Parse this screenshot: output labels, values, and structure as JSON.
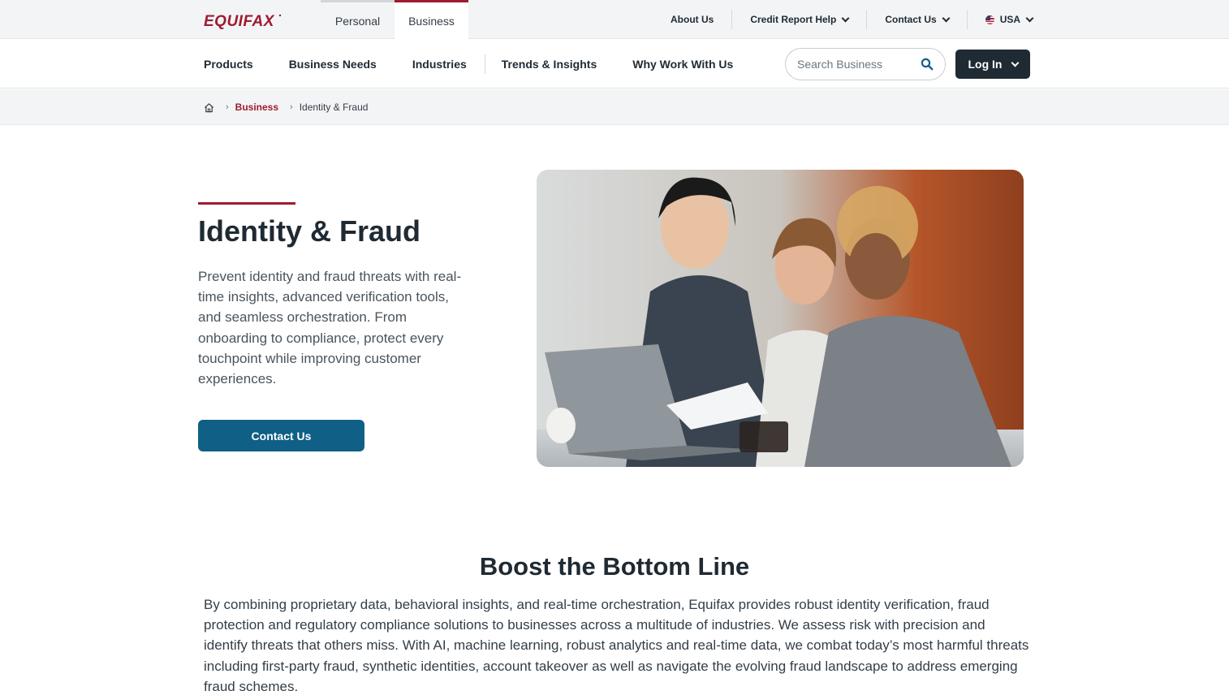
{
  "brand": {
    "logo_text": "EQUIFAX",
    "accent": "#9e1b32",
    "dark": "#1f2a33",
    "cta_blue": "#0f5f86"
  },
  "segment_tabs": {
    "personal": "Personal",
    "business": "Business",
    "active": "Business"
  },
  "utility_nav": {
    "about": "About Us",
    "credit_help": "Credit Report Help",
    "contact": "Contact Us",
    "region": "USA"
  },
  "main_nav": {
    "items": [
      "Products",
      "Business Needs",
      "Industries",
      "Trends & Insights",
      "Why Work With Us"
    ]
  },
  "search": {
    "placeholder": "Search Business",
    "icon": "search-icon"
  },
  "login": {
    "label": "Log In"
  },
  "breadcrumb": {
    "home_icon": "home-icon",
    "parent": "Business",
    "current": "Identity & Fraud"
  },
  "hero": {
    "title": "Identity & Fraud",
    "description": "Prevent identity and fraud threats with real-time insights, advanced verification tools, and seamless orchestration. From onboarding to compliance, protect every touchpoint while improving customer experiences.",
    "cta": "Contact Us"
  },
  "section": {
    "title": "Boost the Bottom Line",
    "body": "By combining proprietary data, behavioral insights, and real-time orchestration, Equifax provides robust identity verification, fraud protection and regulatory compliance solutions to businesses across a multitude of industries. We assess risk with precision and identify threats that others miss. With AI, machine learning, robust analytics and real-time data, we combat today’s most harmful threats including first-party fraud, synthetic identities, account takeover as well as navigate the evolving fraud landscape to address emerging fraud schemes."
  }
}
